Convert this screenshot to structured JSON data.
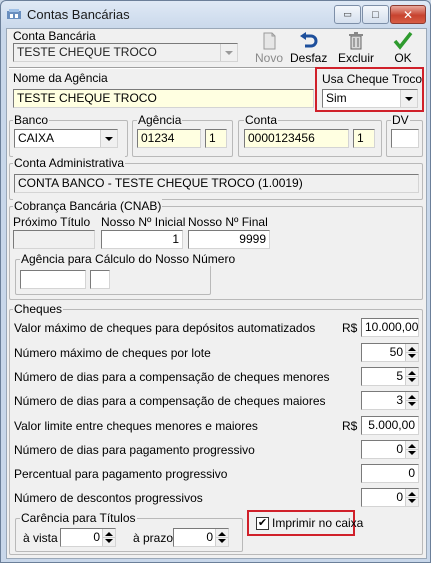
{
  "window": {
    "title": "Contas Bancárias"
  },
  "titlebar": {
    "minimize": "▭",
    "maximize": "□",
    "close": "✕"
  },
  "toolbar": {
    "new_label": "Novo",
    "undo_label": "Desfaz",
    "delete_label": "Excluir",
    "ok_label": "OK"
  },
  "conta": {
    "label": "Conta Bancária",
    "value": "TESTE CHEQUE TROCO"
  },
  "agencia_nome": {
    "label": "Nome da Agência",
    "value": "TESTE CHEQUE TROCO"
  },
  "cheque_troco": {
    "label": "Usa Cheque Troco",
    "value": "Sim"
  },
  "banco": {
    "label": "Banco",
    "value": "CAIXA"
  },
  "agencia": {
    "label": "Agência",
    "number": "01234",
    "digit": "1"
  },
  "conta_num": {
    "label": "Conta",
    "number": "0000123456",
    "digit": "1"
  },
  "dv": {
    "label": "DV",
    "value": ""
  },
  "conta_adm": {
    "label": "Conta Administrativa",
    "value": "CONTA BANCO - TESTE CHEQUE TROCO (1.0019)"
  },
  "cobranca": {
    "label": "Cobrança Bancária (CNAB)",
    "proximo_label": "Próximo Título",
    "proximo_value": "",
    "inicial_label": "Nosso Nº Inicial",
    "inicial_value": "1",
    "final_label": "Nosso Nº Final",
    "final_value": "9999",
    "agencia_calc_label": "Agência para Cálculo do Nosso Número",
    "agencia_calc_value": "",
    "agencia_calc_digit": ""
  },
  "cheques": {
    "label": "Cheques",
    "currency": "R$",
    "rows": [
      {
        "label": "Valor máximo de cheques para depósitos automatizados",
        "value": "10.000,00"
      },
      {
        "label": "Número máximo de cheques por lote",
        "value": "50"
      },
      {
        "label": "Número de dias para a compensação de cheques menores",
        "value": "5"
      },
      {
        "label": "Número de dias para a compensação de cheques maiores",
        "value": "3"
      },
      {
        "label": "Valor limite entre cheques menores e maiores",
        "value": "5.000,00"
      },
      {
        "label": "Número de dias para pagamento progressivo",
        "value": "0"
      },
      {
        "label": "Percentual para pagamento progressivo",
        "value": "0"
      },
      {
        "label": "Número de descontos progressivos",
        "value": "0"
      }
    ],
    "carencia_label": "Carência para Títulos",
    "avista_label": "à vista",
    "avista_value": "0",
    "aprazo_label": "à prazo",
    "aprazo_value": "0",
    "imprimir_label": "Imprimir no caixa",
    "imprimir_checked": "✔"
  },
  "colors": {
    "highlight": "#d0202a",
    "yellow_field": "#ffffe1"
  }
}
